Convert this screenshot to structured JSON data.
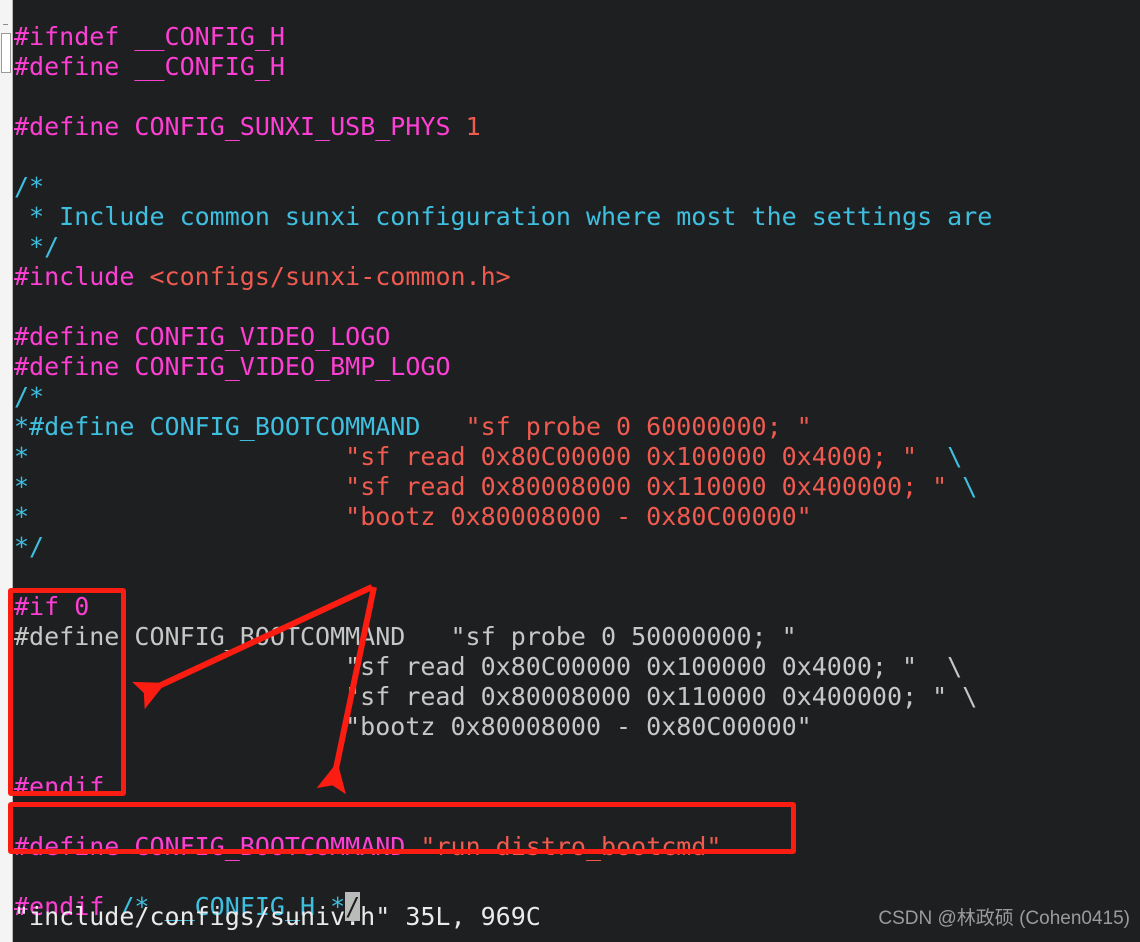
{
  "editor": {
    "name": "vim",
    "background": "#1d1f21",
    "filename": "include/configs/suniv.h"
  },
  "colors": {
    "background": "#1d1f21",
    "preprocessor": "#ff3fd4",
    "hash": "#f05fff",
    "string": "#f05a4f",
    "comment": "#3fbfe0",
    "inactive_region": "#1b93c4",
    "plain_text": "#eaeaea",
    "annotation_red": "#fb1d12",
    "cursor_background": "#b9bcb8",
    "watermark": "#9b9b9b"
  },
  "code": {
    "lines": [
      {
        "n": 1,
        "segments": [
          {
            "t": "#ifndef",
            "c": "pp"
          },
          {
            "t": " ",
            "c": "plain"
          },
          {
            "t": "__CONFIG_H",
            "c": "macro"
          }
        ]
      },
      {
        "n": 2,
        "segments": [
          {
            "t": "#define",
            "c": "pp"
          },
          {
            "t": " ",
            "c": "plain"
          },
          {
            "t": "__CONFIG_H",
            "c": "macro"
          }
        ]
      },
      {
        "n": 3,
        "segments": []
      },
      {
        "n": 4,
        "segments": [
          {
            "t": "#define",
            "c": "pp"
          },
          {
            "t": " ",
            "c": "plain"
          },
          {
            "t": "CONFIG_SUNXI_USB_PHYS",
            "c": "macro"
          },
          {
            "t": " ",
            "c": "plain"
          },
          {
            "t": "1",
            "c": "num"
          }
        ]
      },
      {
        "n": 5,
        "segments": []
      },
      {
        "n": 6,
        "segments": [
          {
            "t": "/*",
            "c": "comment"
          }
        ]
      },
      {
        "n": 7,
        "segments": [
          {
            "t": " * Include common sunxi configuration where most the settings are",
            "c": "comment"
          }
        ]
      },
      {
        "n": 8,
        "segments": [
          {
            "t": " */",
            "c": "comment"
          }
        ]
      },
      {
        "n": 9,
        "segments": [
          {
            "t": "#include",
            "c": "pp"
          },
          {
            "t": " ",
            "c": "plain"
          },
          {
            "t": "<configs/sunxi-common.h>",
            "c": "str"
          }
        ]
      },
      {
        "n": 10,
        "segments": []
      },
      {
        "n": 11,
        "segments": [
          {
            "t": "#define",
            "c": "pp"
          },
          {
            "t": " ",
            "c": "plain"
          },
          {
            "t": "CONFIG_VIDEO_LOGO",
            "c": "macro"
          }
        ]
      },
      {
        "n": 12,
        "segments": [
          {
            "t": "#define",
            "c": "pp"
          },
          {
            "t": " ",
            "c": "plain"
          },
          {
            "t": "CONFIG_VIDEO_BMP_LOGO",
            "c": "macro"
          }
        ]
      },
      {
        "n": 13,
        "segments": [
          {
            "t": "/*",
            "c": "comment"
          }
        ]
      },
      {
        "n": 14,
        "segments": [
          {
            "t": "*#define CONFIG_BOOTCOMMAND   ",
            "c": "comment"
          },
          {
            "t": "\"sf probe 0 60000000; \"",
            "c": "str"
          }
        ]
      },
      {
        "n": 15,
        "segments": [
          {
            "t": "*                     ",
            "c": "comment"
          },
          {
            "t": "\"sf read 0x80C00000 0x100000 0x4000; \"",
            "c": "str"
          },
          {
            "t": "  \\",
            "c": "cont"
          }
        ]
      },
      {
        "n": 16,
        "segments": [
          {
            "t": "*                     ",
            "c": "comment"
          },
          {
            "t": "\"sf read 0x80008000 0x110000 0x400000; \"",
            "c": "str"
          },
          {
            "t": " \\",
            "c": "cont"
          }
        ]
      },
      {
        "n": 17,
        "segments": [
          {
            "t": "*                     ",
            "c": "comment"
          },
          {
            "t": "\"bootz 0x80008000 - 0x80C00000\"",
            "c": "str"
          }
        ]
      },
      {
        "n": 18,
        "segments": [
          {
            "t": "*/",
            "c": "comment"
          }
        ]
      },
      {
        "n": 19,
        "segments": []
      },
      {
        "n": 20,
        "segments": [
          {
            "t": "#if",
            "c": "pp"
          },
          {
            "t": " ",
            "c": "plain"
          },
          {
            "t": "0",
            "c": "pp"
          }
        ]
      },
      {
        "n": 21,
        "segments": [
          {
            "t": "#define CONFIG_BOOTCOMMAND   \"sf probe 0 50000000; \"",
            "c": "inactive"
          }
        ]
      },
      {
        "n": 22,
        "segments": [
          {
            "t": "                      \"sf read 0x80C00000 0x100000 0x4000; \"  \\",
            "c": "inactive"
          }
        ]
      },
      {
        "n": 23,
        "segments": [
          {
            "t": "                      \"sf read 0x80008000 0x110000 0x400000; \" \\",
            "c": "inactive"
          }
        ]
      },
      {
        "n": 24,
        "segments": [
          {
            "t": "                      \"bootz 0x80008000 - 0x80C00000\"",
            "c": "inactive"
          }
        ]
      },
      {
        "n": 25,
        "segments": []
      },
      {
        "n": 26,
        "segments": [
          {
            "t": "#endif",
            "c": "pp"
          }
        ]
      },
      {
        "n": 27,
        "segments": []
      },
      {
        "n": 28,
        "segments": [
          {
            "t": "#define",
            "c": "pp"
          },
          {
            "t": " ",
            "c": "plain"
          },
          {
            "t": "CONFIG_BOOTCOMMAND",
            "c": "macro"
          },
          {
            "t": " ",
            "c": "plain"
          },
          {
            "t": "\"run distro_bootcmd\"",
            "c": "str"
          }
        ]
      },
      {
        "n": 29,
        "segments": []
      },
      {
        "n": 30,
        "segments": [
          {
            "t": "#endif",
            "c": "pp"
          },
          {
            "t": " ",
            "c": "plain"
          },
          {
            "t": "/* __CONFIG_H *",
            "c": "comment"
          },
          {
            "t": "/",
            "c": "cursor"
          }
        ]
      }
    ]
  },
  "statusline": {
    "text": "\"include/configs/suniv.h\" 35L, 969C"
  },
  "annotations": {
    "box_if0_label": "#if 0 block highlight",
    "box_define_label": "active CONFIG_BOOTCOMMAND define highlight",
    "arrow_left_label": "arrow pointing to disabled #if 0 block",
    "arrow_down_label": "arrow pointing to active define line"
  },
  "watermark": {
    "text": "CSDN @林政硕 (Cohen0415)"
  }
}
